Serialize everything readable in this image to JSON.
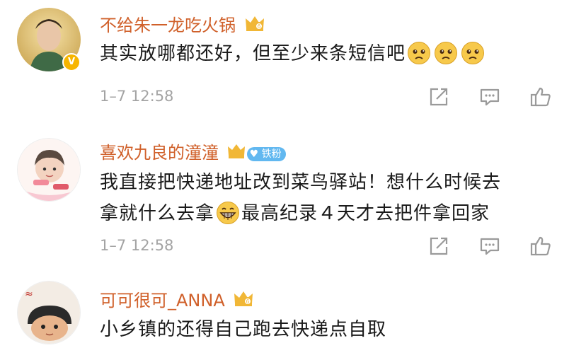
{
  "comments": [
    {
      "username": "不给朱一龙吃火锅",
      "text": "其实放哪都还好，但至少来条短信吧",
      "time": "1–7 12:58",
      "emojis": [
        "sad-face-icon",
        "sad-face-icon",
        "sad-face-icon"
      ],
      "verified_badge": "V"
    },
    {
      "username": "喜欢九良的潼潼",
      "fan_badge": "铁粉",
      "text_line1": "我直接把快递地址改到菜鸟驿站！想什么时候去",
      "text_line2_a": "拿就什么去拿",
      "text_line2_b": "最高纪录４天才去把件拿回家",
      "time": "1–7 12:58",
      "emojis": [
        "grin-face-icon"
      ]
    },
    {
      "username": "可可很可_ANNA",
      "text": "小乡镇的还得自己跑去快递点自取"
    }
  ],
  "colors": {
    "username": "#d0602a",
    "time": "#a3a3a3",
    "icon": "#9a9a9a",
    "fan_badge": "#62b8f0",
    "crown": "#f1b736"
  }
}
